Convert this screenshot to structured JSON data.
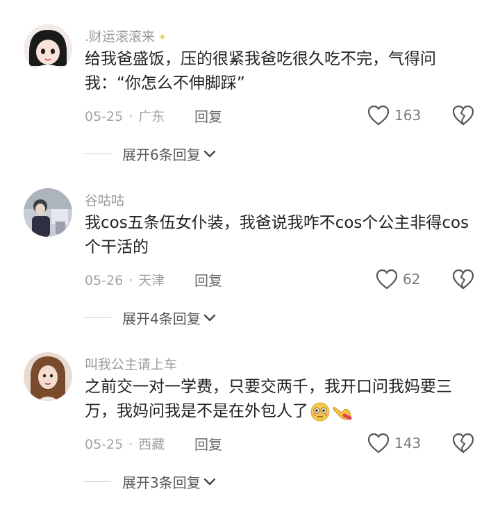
{
  "comments": [
    {
      "username": ".财运滚滚来",
      "text": "给我爸盛饭，压的很紧我爸吃很久吃不完，气得问我：“你怎么不伸脚踩”",
      "date": "05-25",
      "location": "广东",
      "reply_label": "回复",
      "likes": "163",
      "expand_label": "展开6条回复"
    },
    {
      "username": "谷咕咕",
      "text": "我cos五条伍女仆装，我爸说我咋不cos个公主非得cos个干活的",
      "date": "05-26",
      "location": "天津",
      "reply_label": "回复",
      "likes": "62",
      "expand_label": "展开4条回复"
    },
    {
      "username": "叫我公主请上车",
      "text": "之前交一对一学费，只要交两千，我开口问我妈要三万，我妈问我是不是在外包人了",
      "date": "05-25",
      "location": "西藏",
      "reply_label": "回复",
      "likes": "143",
      "expand_label": "展开3条回复"
    }
  ],
  "icons": {
    "sparkle": "sparkle-icon",
    "like": "heart-outline-icon",
    "dislike": "broken-heart-icon",
    "chevron": "chevron-down-icon",
    "emoji_face": "flushed-face-emoji",
    "emoji_hand": "pointing-hand-emoji"
  },
  "colors": {
    "username": "#9a9a9a",
    "text": "#1f1f1f",
    "meta": "#a3a3a3",
    "icon": "#555555"
  }
}
